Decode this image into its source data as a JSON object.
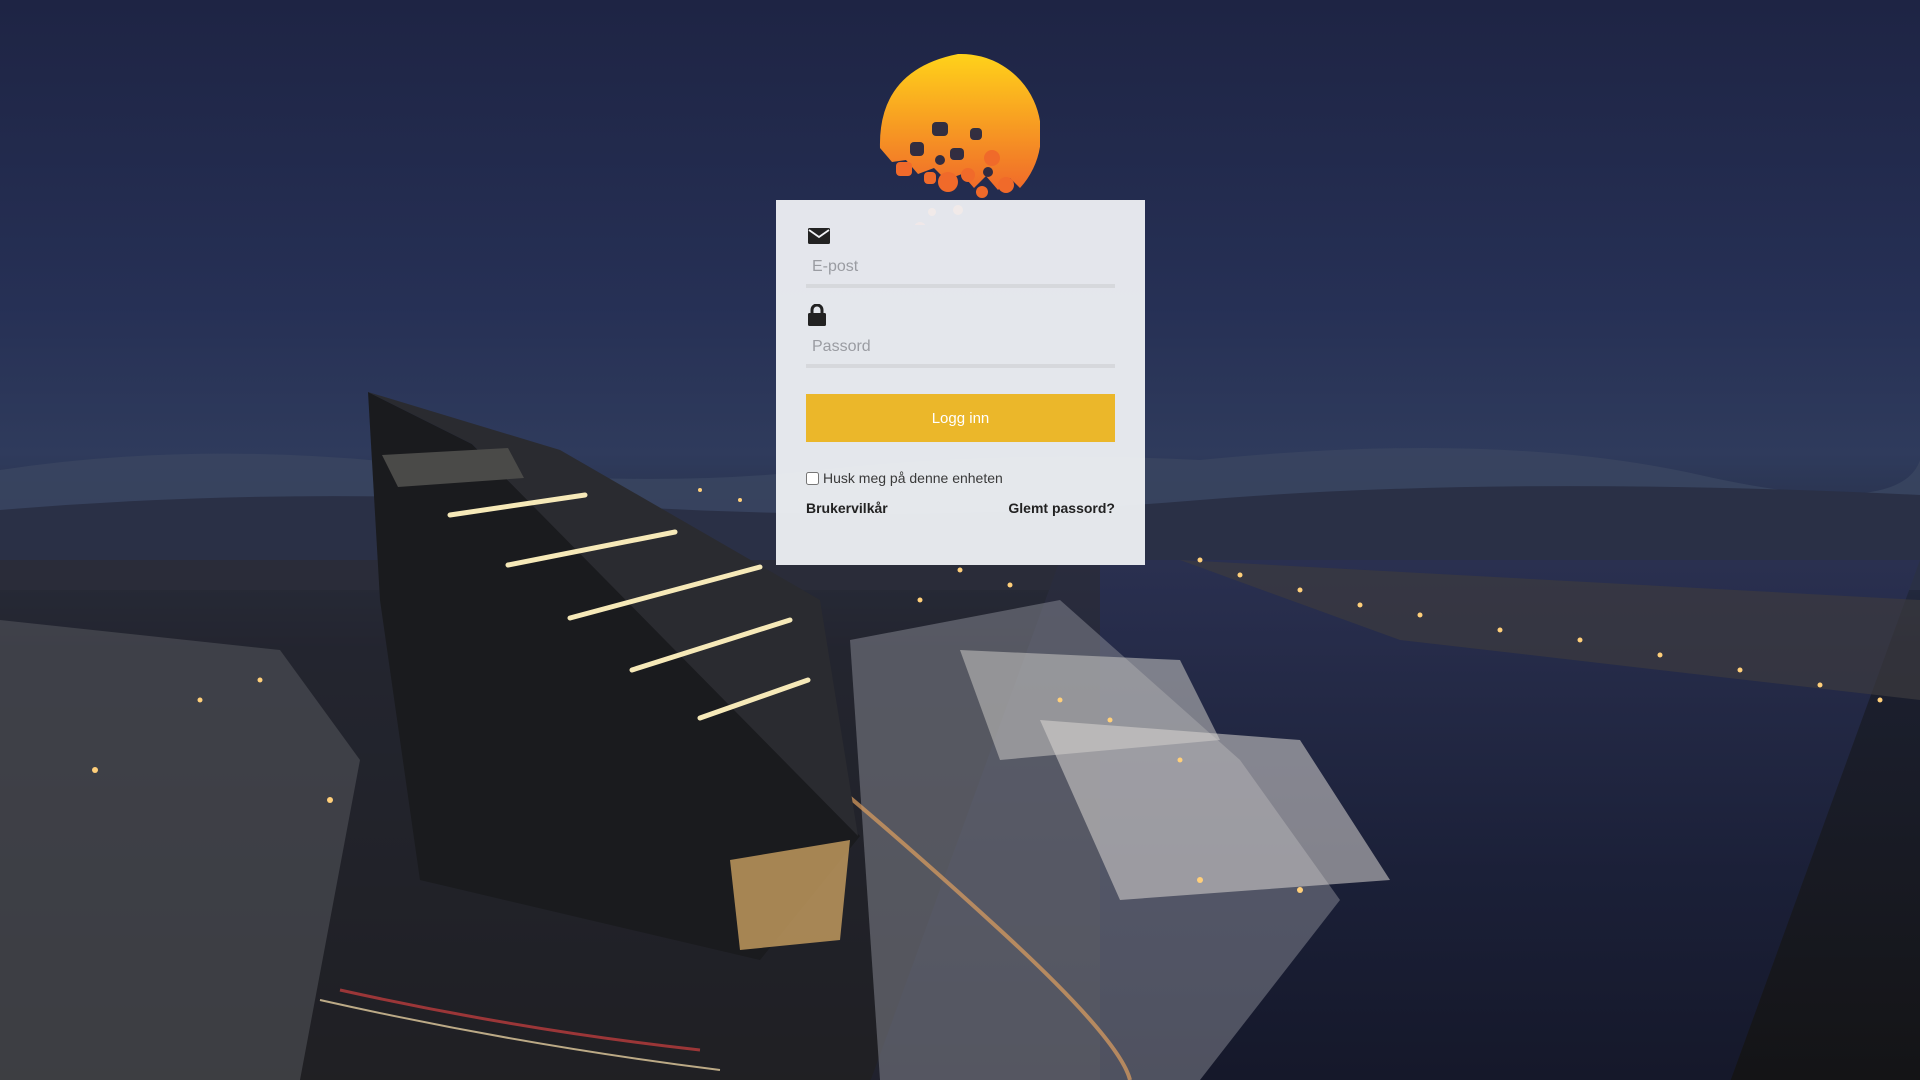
{
  "login": {
    "email_placeholder": "E-post",
    "password_placeholder": "Passord",
    "submit_label": "Logg inn",
    "remember_label": "Husk meg på denne enheten",
    "terms_link": "Brukervilkår",
    "forgot_link": "Glemt passord?"
  },
  "icons": {
    "email": "envelope-icon",
    "password": "lock-icon",
    "logo": "brand-logo"
  },
  "colors": {
    "accent": "#ebb72a",
    "logo_top": "#ffd21a",
    "logo_bottom": "#f06a2a",
    "card_bg": "#f0f2f5",
    "sky": "#263055"
  }
}
